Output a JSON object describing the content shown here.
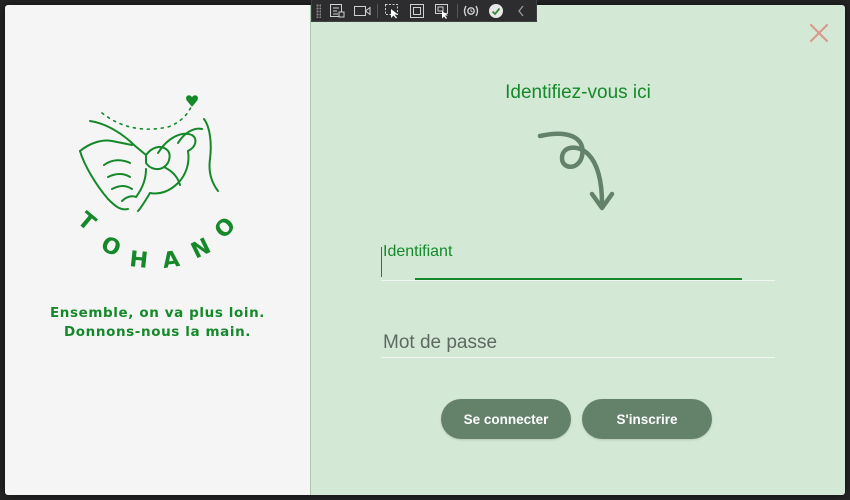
{
  "brand": {
    "name": "TOHANO",
    "letters": [
      "T",
      "O",
      "H",
      "A",
      "N",
      "O"
    ],
    "tagline_line1": "Ensemble, on va plus loin.",
    "tagline_line2": "Donnons-nous la main.",
    "color": "#15892a"
  },
  "devtools": {
    "buttons": [
      {
        "icon": "live-visual-tree-icon"
      },
      {
        "icon": "record-video-icon"
      },
      {
        "icon": "select-element-icon"
      },
      {
        "icon": "display-layout-adorners-icon"
      },
      {
        "icon": "track-focused-element-icon"
      },
      {
        "icon": "hot-reload-icon"
      },
      {
        "icon": "binding-ok-icon"
      },
      {
        "icon": "collapse-chevron-icon"
      }
    ]
  },
  "login": {
    "title": "Identifiez-vous ici",
    "username_label": "Identifiant",
    "username_value": "",
    "password_label": "Mot de passe",
    "password_value": "",
    "login_button": "Se connecter",
    "signup_button": "S'inscrire",
    "close_icon": "close-icon"
  },
  "colors": {
    "accent": "#15892a",
    "right_panel_bg": "#d3e9d5",
    "left_panel_bg": "#f5f5f5",
    "button_bg": "#64826a",
    "close_icon": "#d89a8c"
  }
}
